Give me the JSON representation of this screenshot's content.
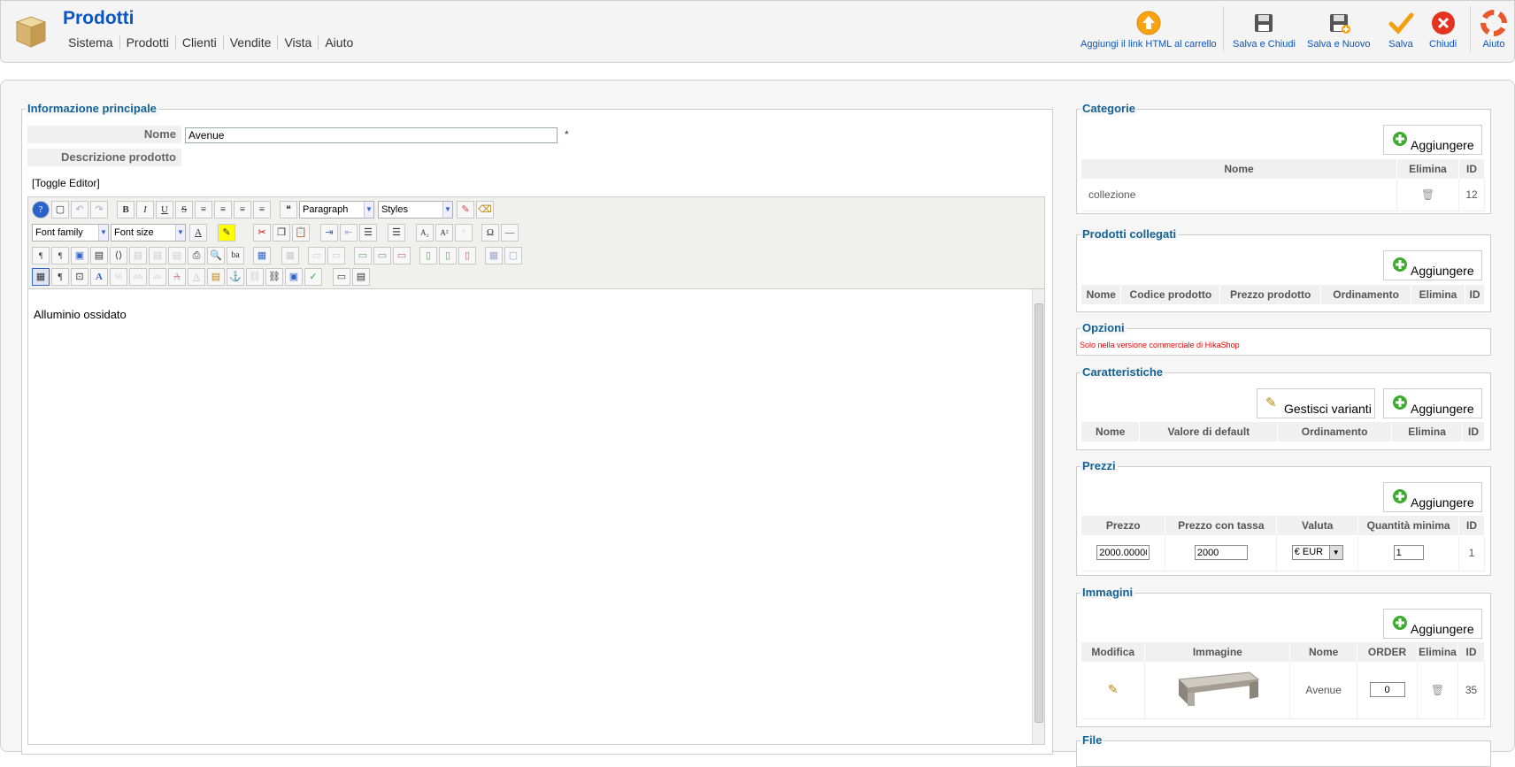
{
  "header": {
    "title": "Prodotti",
    "menu": [
      "Sistema",
      "Prodotti",
      "Clienti",
      "Vendite",
      "Vista",
      "Aiuto"
    ],
    "toolbar": {
      "add_html_link": "Aggiungi il link HTML al carrello",
      "save_close": "Salva e Chiudi",
      "save_new": "Salva e Nuovo",
      "save": "Salva",
      "close": "Chiudi",
      "help": "Aiuto"
    }
  },
  "main": {
    "legend": "Informazione principale",
    "name_label": "Nome",
    "name_value": "Avenue",
    "required_mark": "*",
    "desc_label": "Descrizione prodotto",
    "toggle_editor": "[Toggle Editor]",
    "editor": {
      "format_select": "Paragraph",
      "styles_select": "Styles",
      "font_family": "Font family",
      "font_size": "Font size",
      "content": "Alluminio ossidato"
    }
  },
  "categories": {
    "legend": "Categorie",
    "add": "Aggiungere",
    "columns": [
      "Nome",
      "Elimina",
      "ID"
    ],
    "rows": [
      {
        "name": "collezione",
        "id": "12"
      }
    ]
  },
  "linked": {
    "legend": "Prodotti collegati",
    "add": "Aggiungere",
    "columns": [
      "Nome",
      "Codice prodotto",
      "Prezzo prodotto",
      "Ordinamento",
      "Elimina",
      "ID"
    ]
  },
  "options": {
    "legend": "Opzioni",
    "note": "Solo nella versione commerciale di HikaShop"
  },
  "features": {
    "legend": "Caratteristiche",
    "manage": "Gestisci varianti",
    "add": "Aggiungere",
    "columns": [
      "Nome",
      "Valore di default",
      "Ordinamento",
      "Elimina",
      "ID"
    ]
  },
  "prices": {
    "legend": "Prezzi",
    "add": "Aggiungere",
    "columns": [
      "Prezzo",
      "Prezzo con tassa",
      "Valuta",
      "Quantità minima",
      "ID"
    ],
    "row": {
      "price": "2000.00000",
      "price_tax": "2000",
      "currency": "€ EUR",
      "min_qty": "1",
      "id": "1"
    }
  },
  "images": {
    "legend": "Immagini",
    "add": "Aggiungere",
    "columns": [
      "Modifica",
      "Immagine",
      "Nome",
      "ORDER",
      "Elimina",
      "ID"
    ],
    "row": {
      "name": "Avenue",
      "order": "0",
      "id": "35"
    }
  },
  "files": {
    "legend": "File"
  },
  "colors": {
    "brand": "#0b55c4",
    "legend": "#146295",
    "accent_green": "#3dab2e"
  }
}
